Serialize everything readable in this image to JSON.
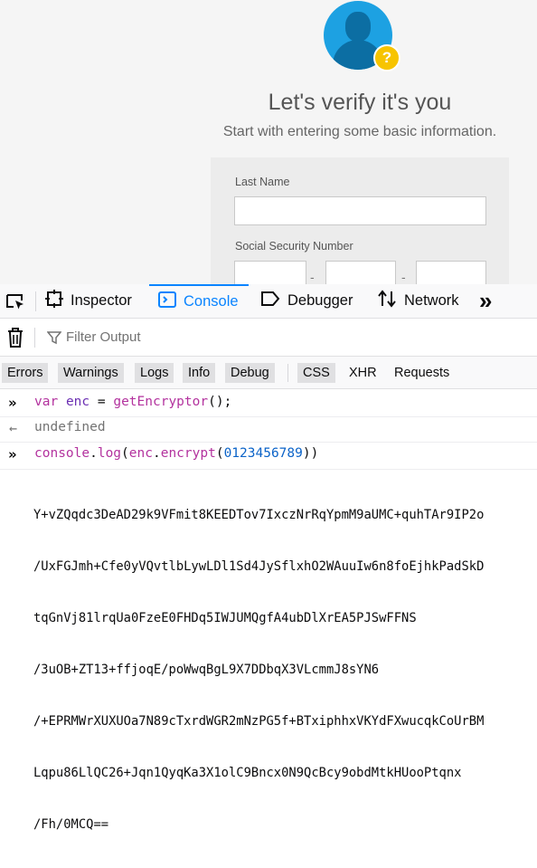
{
  "page": {
    "title": "Let's verify it's you",
    "subtitle": "Start with entering some basic information.",
    "form": {
      "last_name_label": "Last Name",
      "last_name_value": "",
      "ssn_label": "Social Security Number",
      "ssn_separator": "-"
    },
    "avatar_badge": "?"
  },
  "devtools": {
    "tabs": [
      {
        "label": "Inspector",
        "icon": "inspector-icon"
      },
      {
        "label": "Console",
        "icon": "console-icon",
        "selected": true
      },
      {
        "label": "Debugger",
        "icon": "debugger-icon"
      },
      {
        "label": "Network",
        "icon": "network-icon"
      }
    ],
    "overflow_glyph": "»",
    "filter_placeholder": "Filter Output",
    "categories": [
      {
        "label": "Errors",
        "on": true
      },
      {
        "label": "Warnings",
        "on": true
      },
      {
        "label": "Logs",
        "on": true
      },
      {
        "label": "Info",
        "on": true
      },
      {
        "label": "Debug",
        "on": true
      },
      {
        "label": "CSS",
        "on": true
      },
      {
        "label": "XHR",
        "on": false
      },
      {
        "label": "Requests",
        "on": false
      }
    ],
    "console": {
      "line1": {
        "kw": "var",
        "id": "enc",
        "op": "=",
        "fn": "getEncryptor",
        "tail": "();"
      },
      "result1": "undefined",
      "line2": {
        "obj": "console",
        "dot1": ".",
        "method": "log",
        "open": "(",
        "arg_obj": "enc",
        "dot2": ".",
        "arg_method": "encrypt",
        "open2": "(",
        "num": "0123456789",
        "close": "))"
      },
      "output": [
        "Y+vZQqdc3DeAD29k9VFmit8KEEDTov7IxczNrRqYpmM9aUMC+quhTAr9IP2o",
        "/UxFGJmh+Cfe0yVQvtlbLywLDl1Sd4JySflxhO2WAuuIw6n8foEjhkPadSkD",
        "tqGnVj81lrqUa0FzeE0FHDq5IWJUMQgfA4ubDlXrEA5PJSwFFNS",
        "/3uOB+ZT13+ffjoqE/poWwqBgL9X7DDbqX3VLcmmJ8sYN6",
        "/+EPRMWrXUXUOa7N89cTxrdWGR2mNzPG5f+BTxiphhxVKYdFXwucqkCoUrBM",
        "Lqpu86LlQC26+Jqn1QyqKa3X1olC9Bncx0N9QcBcy9obdMtkHUooPtqnx",
        "/Fh/0MCQ=="
      ]
    }
  },
  "colors": {
    "accent": "#0a84ff",
    "avatar": "#1da1e2",
    "badge": "#f7c400"
  }
}
